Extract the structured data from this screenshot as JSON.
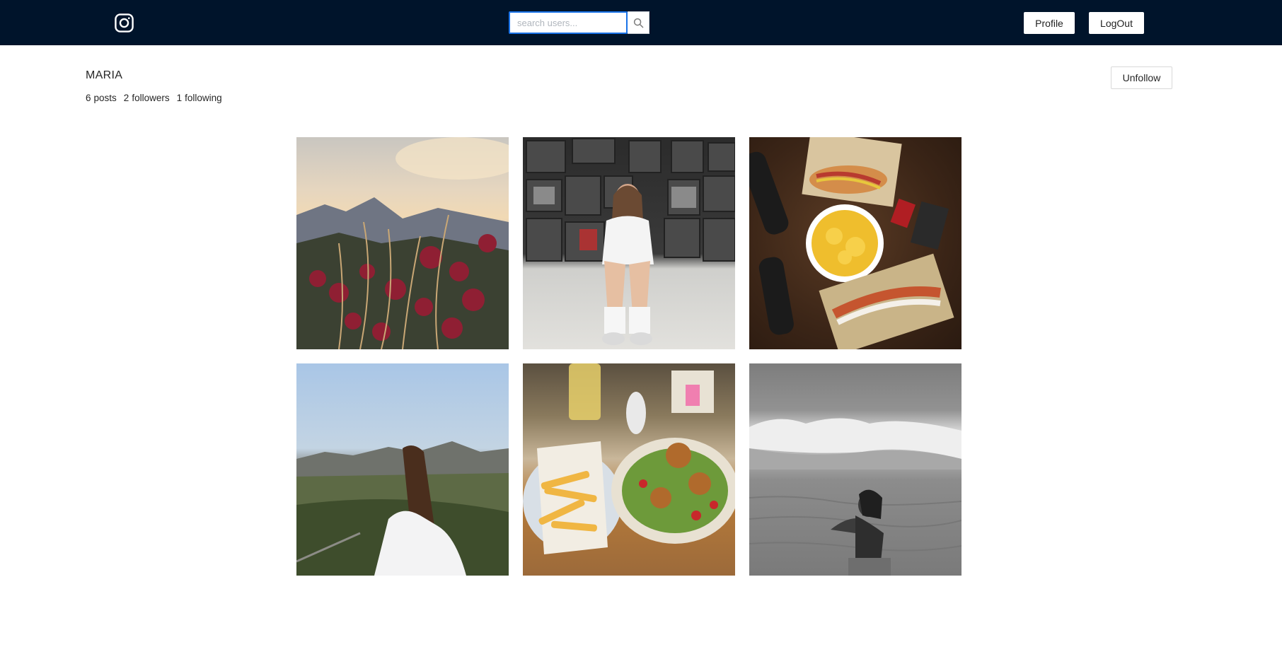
{
  "navbar": {
    "logo_icon": "instagram-icon",
    "search": {
      "placeholder": "search users...",
      "value": "",
      "button_icon": "search-icon"
    },
    "profile_label": "Profile",
    "logout_label": "LogOut"
  },
  "profile": {
    "username": "MARIA",
    "stats": {
      "posts_count": "6",
      "posts_label": "posts",
      "followers_count": "2",
      "followers_label": "followers",
      "following_count": "1",
      "following_label": "following"
    },
    "unfollow_label": "Unfollow"
  },
  "colors": {
    "navbar_bg": "#00142b",
    "search_focus_border": "#1a73e8",
    "page_bg": "#ffffff"
  },
  "posts": [
    {
      "subject": "sunset-mountains-flowers-photo"
    },
    {
      "subject": "girl-sitting-before-tv-wall-photo"
    },
    {
      "subject": "hotdogs-and-fries-on-table-photo"
    },
    {
      "subject": "girl-overlooking-valley-photo"
    },
    {
      "subject": "fries-and-salad-plates-photo"
    },
    {
      "subject": "woman-in-sea-waves-bw-photo"
    }
  ]
}
